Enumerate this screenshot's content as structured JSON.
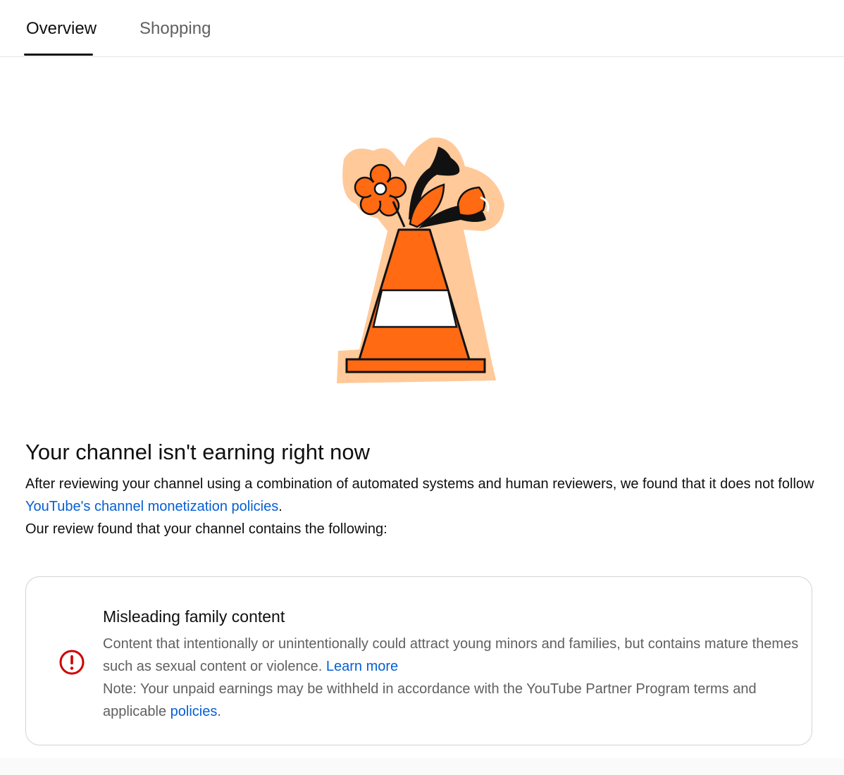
{
  "tabs": {
    "overview": "Overview",
    "shopping": "Shopping",
    "active": "Overview"
  },
  "main": {
    "title": "Your channel isn't earning right now",
    "intro_before_link": "After reviewing your channel using a combination of automated systems and human reviewers, we found that it does not follow ",
    "intro_link": "YouTube's channel monetization policies",
    "intro_after_link": ".",
    "review_line": "Our review found that your channel contains the following:"
  },
  "issue_card": {
    "icon": "error-icon",
    "title": "Misleading family content",
    "description": "Content that intentionally or unintentionally could attract young minors and families, but contains mature themes such as sexual content or violence.",
    "learn_more": "Learn more",
    "note_before_link": "Note: Your unpaid earnings may be withheld in accordance with the YouTube Partner Program terms and applicable ",
    "note_link": "policies",
    "note_after_link": "."
  },
  "colors": {
    "link": "#065fd4",
    "error": "#cc0000",
    "cone_orange": "#ff6a13",
    "cone_outline": "#ffc999"
  }
}
